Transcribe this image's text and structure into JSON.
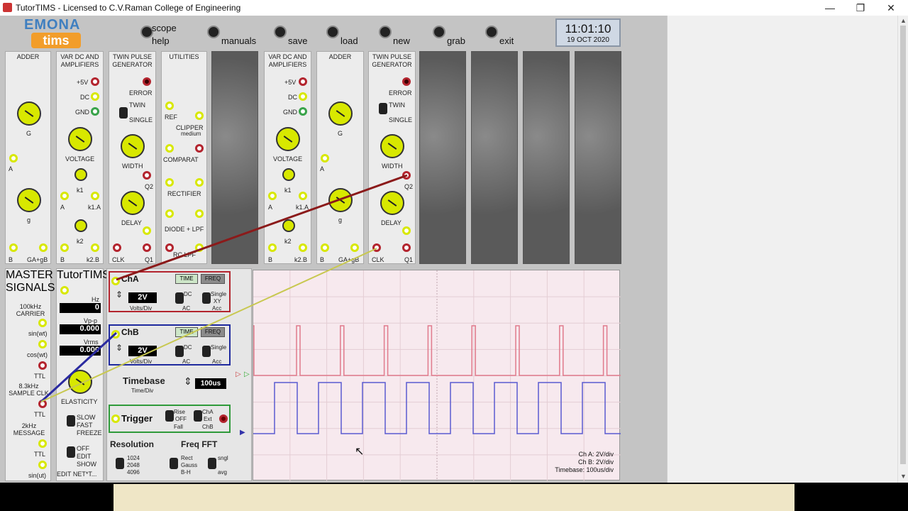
{
  "window": {
    "title": "TutorTIMS - Licensed to C.V.Raman College of Engineering",
    "controls": [
      "—",
      "❐",
      "✕"
    ]
  },
  "logo": {
    "top": "EMONA",
    "bottom": "tims"
  },
  "toolbar": [
    {
      "label": "scope",
      "label2": "help"
    },
    {
      "label": "manuals"
    },
    {
      "label": "save"
    },
    {
      "label": "load"
    },
    {
      "label": "new"
    },
    {
      "label": "grab"
    },
    {
      "label": "exit"
    }
  ],
  "clock": {
    "time": "11:01:10",
    "date": "19 OCT 2020"
  },
  "modules_top": [
    {
      "title": "ADDER",
      "labels": [
        "G",
        "A",
        "g",
        "B",
        "GA+gB"
      ]
    },
    {
      "title": "VAR DC AND AMPLIFIERS",
      "labels": [
        "+5V",
        "DC",
        "GND",
        "VOLTAGE",
        "k1",
        "A",
        "k1.A",
        "k2",
        "B",
        "k2.B"
      ]
    },
    {
      "title": "TWIN PULSE GENERATOR",
      "labels": [
        "ERROR",
        "TWIN",
        "SINGLE",
        "WIDTH",
        "Q2",
        "DELAY",
        "CLK",
        "Q1"
      ]
    },
    {
      "title": "UTILITIES",
      "labels": [
        "REF",
        "CLIPPER",
        "medium",
        "COMPARAT",
        "RECTIFIER",
        "DIODE + LPF",
        "RC LPF"
      ]
    },
    {
      "title": "VAR DC AND AMPLIFIERS",
      "labels": [
        "+5V",
        "DC",
        "GND",
        "VOLTAGE",
        "k1",
        "A",
        "k1.A",
        "k2",
        "B",
        "k2.B"
      ]
    },
    {
      "title": "ADDER",
      "labels": [
        "G",
        "A",
        "g",
        "B",
        "GA+gB"
      ]
    },
    {
      "title": "TWIN PULSE GENERATOR",
      "labels": [
        "ERROR",
        "TWIN",
        "SINGLE",
        "WIDTH",
        "Q2",
        "DELAY",
        "CLK",
        "Q1"
      ]
    }
  ],
  "master": {
    "title": "MASTER SIGNALS",
    "carrier": "100kHz CARRIER",
    "sin": "sin(wt)",
    "cos": "cos(wt)",
    "ttl1": "TTL",
    "sample": "8.3kHz SAMPLE CLK",
    "ttl2": "TTL",
    "message": "2kHz MESSAGE",
    "ttl3": "TTL",
    "sinut": "sin(ut)"
  },
  "tutortims": {
    "title": "TutorTIMS",
    "hz_label": "Hz",
    "hz_value": "0",
    "vpp_label": "Vp-p",
    "vpp_value": "0.000",
    "vrms_label": "Vrms",
    "vrms_value": "0.000",
    "elasticity": "ELASTICITY",
    "speed": [
      "SLOW",
      "FAST",
      "FREEZE"
    ],
    "edit": [
      "OFF",
      "EDIT",
      "SHOW"
    ],
    "editnet": "EDIT NET*T..."
  },
  "chA": {
    "name": "ChA",
    "time": "TIME",
    "freq": "FREQ",
    "vdiv": "2V",
    "vdiv_label": "Volts/Div",
    "dc": "DC",
    "ac": "AC",
    "single": "Single",
    "xy": "XY",
    "acc": "Acc",
    "color": "#b3242e"
  },
  "chB": {
    "name": "ChB",
    "time": "TIME",
    "freq": "FREQ",
    "vdiv": "2V",
    "vdiv_label": "Volts/Div",
    "dc": "DC",
    "ac": "AC",
    "single": "Single",
    "acc": "Acc",
    "color": "#1f2a9e"
  },
  "timebase": {
    "label": "Timebase",
    "sub": "Time/Div",
    "value": "100us"
  },
  "trigger": {
    "label": "Trigger",
    "rise": "Rise",
    "off": "OFF",
    "fall": "Fall",
    "cha": "ChA",
    "ext": "Ext",
    "chb": "ChB",
    "color": "#2f9a3a"
  },
  "resolution": {
    "label": "Resolution",
    "opts": [
      "1024",
      "2048",
      "4096"
    ]
  },
  "fft": {
    "label": "Freq FFT",
    "opts": [
      "Rect",
      "Gauss",
      "B-H"
    ],
    "sngl": "sngl",
    "avg": "avg"
  },
  "scope_info": {
    "a": "Ch A: 2V/div",
    "b": "Ch B: 2V/div",
    "tb": "Timebase: 100us/div"
  },
  "colors": {
    "trace_a": "#e07a8c",
    "trace_b": "#5a5ad0",
    "wire_red": "#8b1a1a",
    "wire_yellow": "#c8c850",
    "wire_blue": "#2a2aa0"
  }
}
